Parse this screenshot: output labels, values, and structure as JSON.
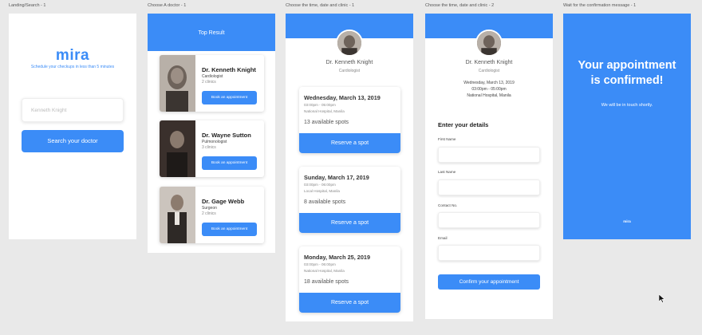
{
  "artboards": [
    {
      "label": "Landing/Search - 1"
    },
    {
      "label": "Choose A doctor - 1"
    },
    {
      "label": "Choose the time, date and clinic - 1"
    },
    {
      "label": "Choose the time, date and clinic - 2"
    },
    {
      "label": "Wait for the confirmation message - 1"
    }
  ],
  "landing": {
    "logo": "mira",
    "tagline": "Schedule your checkups in less than 5 minutes",
    "search_placeholder": "Kenneth Knight",
    "search_button": "Search your doctor"
  },
  "doctors_screen": {
    "header": "Top Result",
    "doctors": [
      {
        "name": "Dr. Kenneth Knight",
        "specialty": "Cardiologist",
        "clinics": "2 clinics",
        "button": "Book an appointment"
      },
      {
        "name": "Dr. Wayne Sutton",
        "specialty": "Pulmonologist",
        "clinics": "3 clinics",
        "button": "Book an appointment"
      },
      {
        "name": "Dr. Gage Webb",
        "specialty": "Surgeon",
        "clinics": "2 clinics",
        "button": "Book an appointment"
      }
    ]
  },
  "schedule_screen": {
    "doctor_name": "Dr. Kenneth Knight",
    "doctor_specialty": "Cardiologist",
    "slots": [
      {
        "date": "Wednesday, March 13, 2019",
        "time": "03:00pm - 05:00pm",
        "place": "National Hospital, Manila",
        "spots": "13 available spots",
        "button": "Reserve a spot"
      },
      {
        "date": "Sunday, March 17, 2019",
        "time": "03:00pm - 06:00pm",
        "place": "Local Hospital, Manila",
        "spots": "8 available spots",
        "button": "Reserve a spot"
      },
      {
        "date": "Monday, March 25, 2019",
        "time": "03:00pm - 06:00pm",
        "place": "National Hospital, Manila",
        "spots": "18 available spots",
        "button": "Reserve a spot"
      }
    ]
  },
  "details_screen": {
    "doctor_name": "Dr. Kenneth Knight",
    "doctor_specialty": "Cardiologist",
    "selected_date": "Wednesday, March 13, 2019",
    "selected_time": "03:00pm - 05:00pm",
    "selected_place": "National Hospital, Manila",
    "form_title": "Enter your details",
    "fields": [
      {
        "label": "First Name"
      },
      {
        "label": "Last Name"
      },
      {
        "label": "Contact No."
      },
      {
        "label": "Email"
      }
    ],
    "confirm_button": "Confirm your appointment"
  },
  "confirmation_screen": {
    "title_line1": "Your appointment",
    "title_line2": "is confirmed!",
    "subtitle": "We will be in touch shortly.",
    "logo": "mira"
  },
  "colors": {
    "accent": "#3b8cf7",
    "canvas": "#e9e9e9"
  },
  "icons": [
    "cursor-icon",
    "doctor-photo"
  ]
}
